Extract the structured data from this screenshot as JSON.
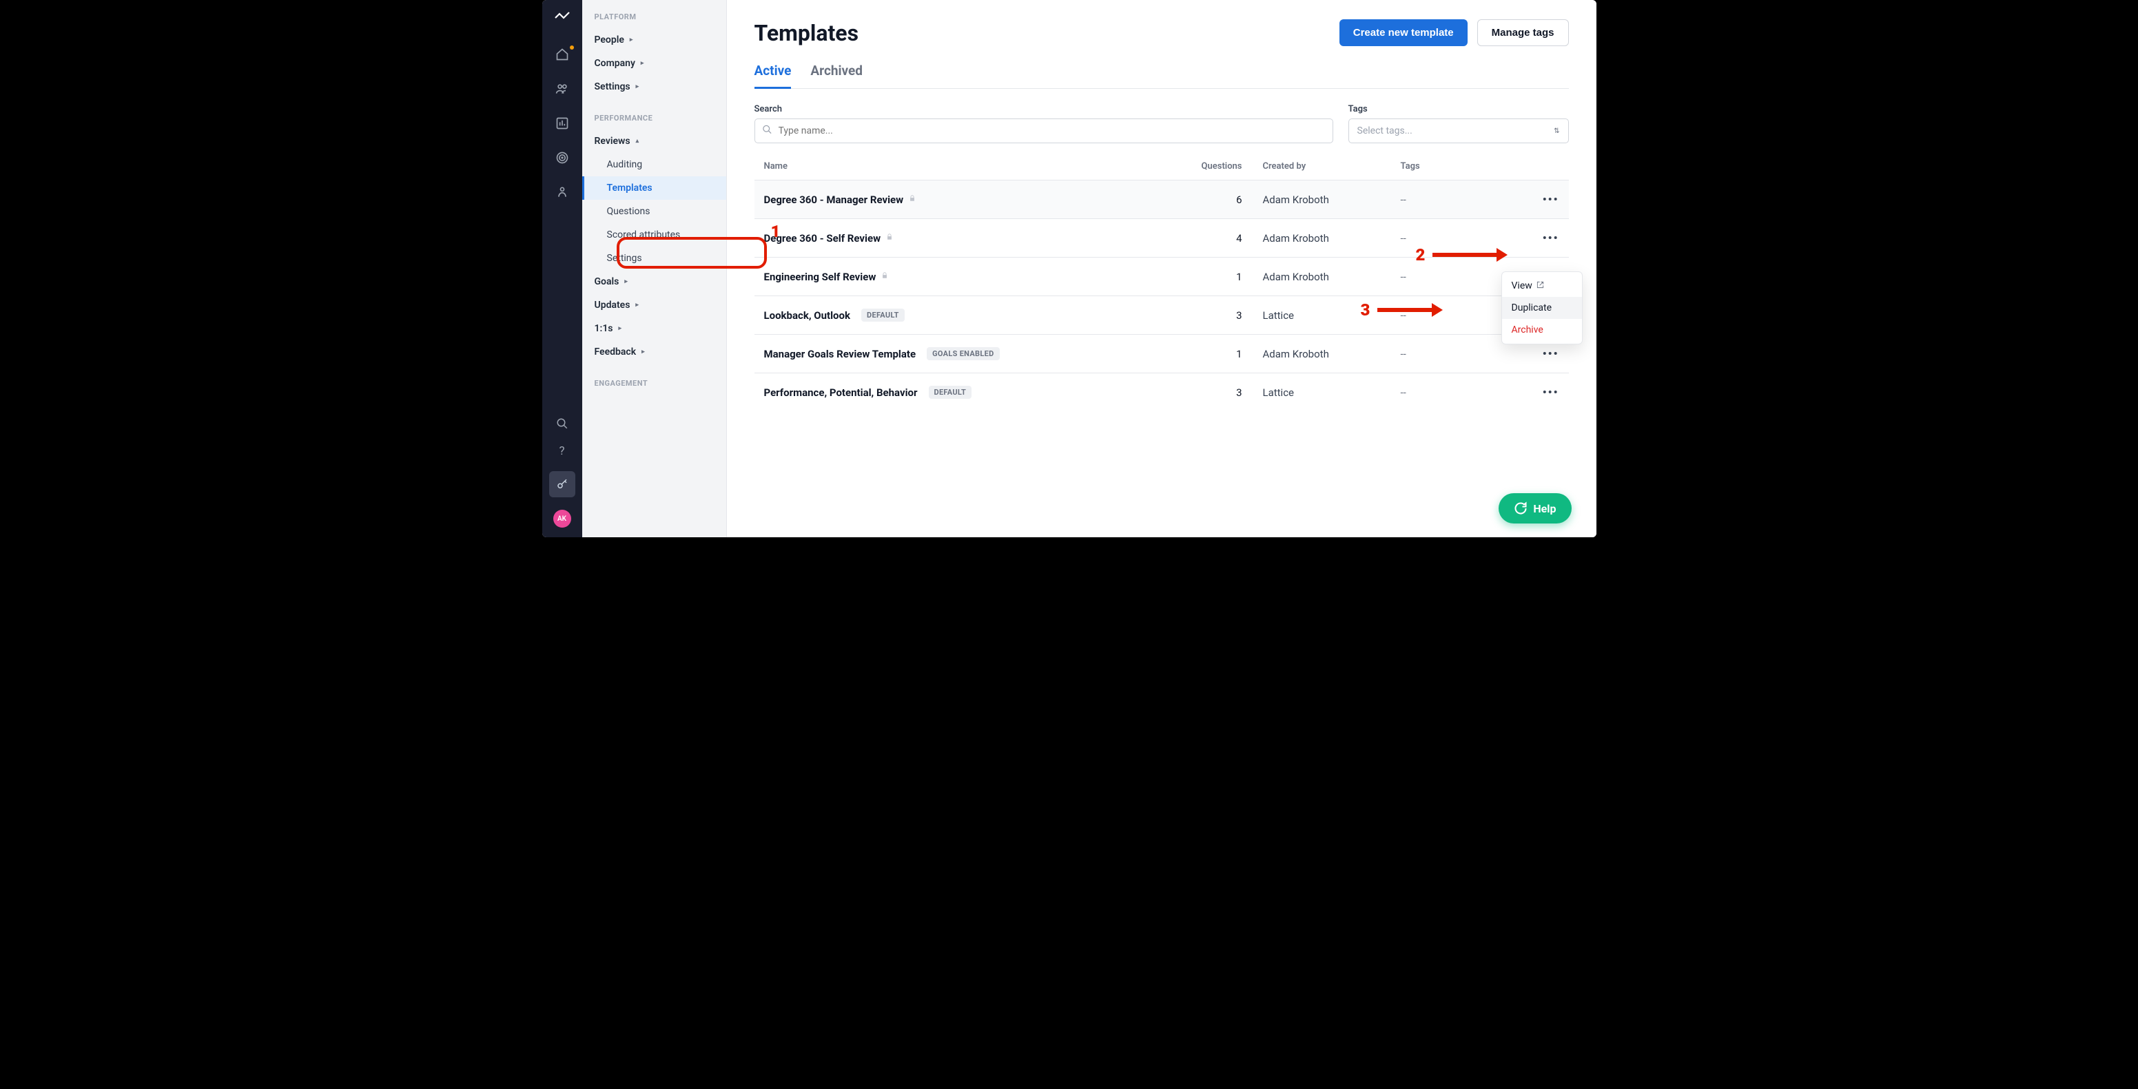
{
  "rail": {
    "avatar_initials": "AK"
  },
  "sidebar": {
    "sections": {
      "platform": {
        "header": "PLATFORM",
        "items": [
          "People",
          "Company",
          "Settings"
        ]
      },
      "performance": {
        "header": "PERFORMANCE",
        "reviews_label": "Reviews",
        "reviews_children": [
          "Auditing",
          "Templates",
          "Questions",
          "Scored attributes",
          "Settings"
        ],
        "rest": [
          "Goals",
          "Updates",
          "1:1s",
          "Feedback"
        ]
      },
      "engagement": {
        "header": "ENGAGEMENT"
      }
    }
  },
  "page": {
    "title": "Templates",
    "actions": {
      "create": "Create new template",
      "manage_tags": "Manage tags"
    },
    "tabs": {
      "active": "Active",
      "archived": "Archived"
    },
    "filters": {
      "search_label": "Search",
      "search_placeholder": "Type name...",
      "tags_label": "Tags",
      "tags_placeholder": "Select tags..."
    },
    "columns": {
      "name": "Name",
      "questions": "Questions",
      "created_by": "Created by",
      "tags": "Tags"
    },
    "rows": [
      {
        "name": "Degree 360 - Manager Review",
        "locked": true,
        "badge": "",
        "questions": "6",
        "created_by": "Adam Kroboth",
        "tags": "--"
      },
      {
        "name": "Degree 360 - Self Review",
        "locked": true,
        "badge": "",
        "questions": "4",
        "created_by": "Adam Kroboth",
        "tags": "--"
      },
      {
        "name": "Engineering Self Review",
        "locked": true,
        "badge": "",
        "questions": "1",
        "created_by": "Adam Kroboth",
        "tags": "--"
      },
      {
        "name": "Lookback, Outlook",
        "locked": false,
        "badge": "DEFAULT",
        "questions": "3",
        "created_by": "Lattice",
        "tags": "--"
      },
      {
        "name": "Manager Goals Review Template",
        "locked": false,
        "badge": "GOALS ENABLED",
        "questions": "1",
        "created_by": "Adam Kroboth",
        "tags": "--"
      },
      {
        "name": "Performance, Potential, Behavior",
        "locked": false,
        "badge": "DEFAULT",
        "questions": "3",
        "created_by": "Lattice",
        "tags": "--"
      }
    ],
    "dropdown": {
      "view": "View",
      "duplicate": "Duplicate",
      "archive": "Archive"
    },
    "help": "Help"
  },
  "annotations": {
    "n1": "1",
    "n2": "2",
    "n3": "3"
  }
}
